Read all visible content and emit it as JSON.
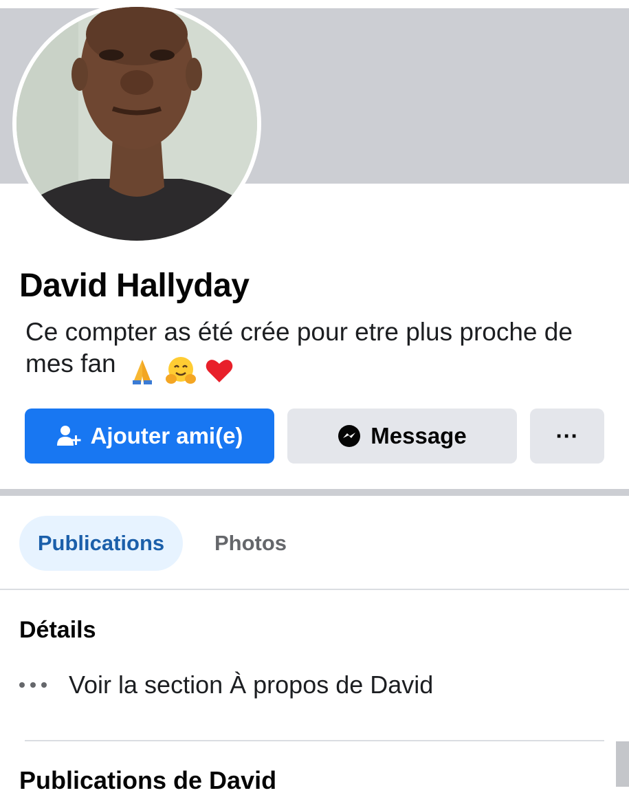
{
  "profile": {
    "name": "David Hallyday",
    "bio": "Ce compter as été crée pour etre plus proche de mes fan",
    "bio_emojis": [
      "folded-hands-emoji",
      "hugging-face-emoji",
      "red-heart-emoji"
    ]
  },
  "actions": {
    "add_friend_label": "Ajouter ami(e)",
    "message_label": "Message",
    "more_label": "···"
  },
  "tabs": [
    {
      "label": "Publications",
      "active": true
    },
    {
      "label": "Photos",
      "active": false
    }
  ],
  "details": {
    "title": "Détails",
    "about_link": "Voir la section À propos de David"
  },
  "posts": {
    "title": "Publications de David"
  },
  "colors": {
    "primary_blue": "#1877f2",
    "cover_gray": "#ccced3",
    "secondary_button": "#e4e6eb",
    "active_tab_bg": "#e7f3ff",
    "active_tab_text": "#1b5faa"
  }
}
